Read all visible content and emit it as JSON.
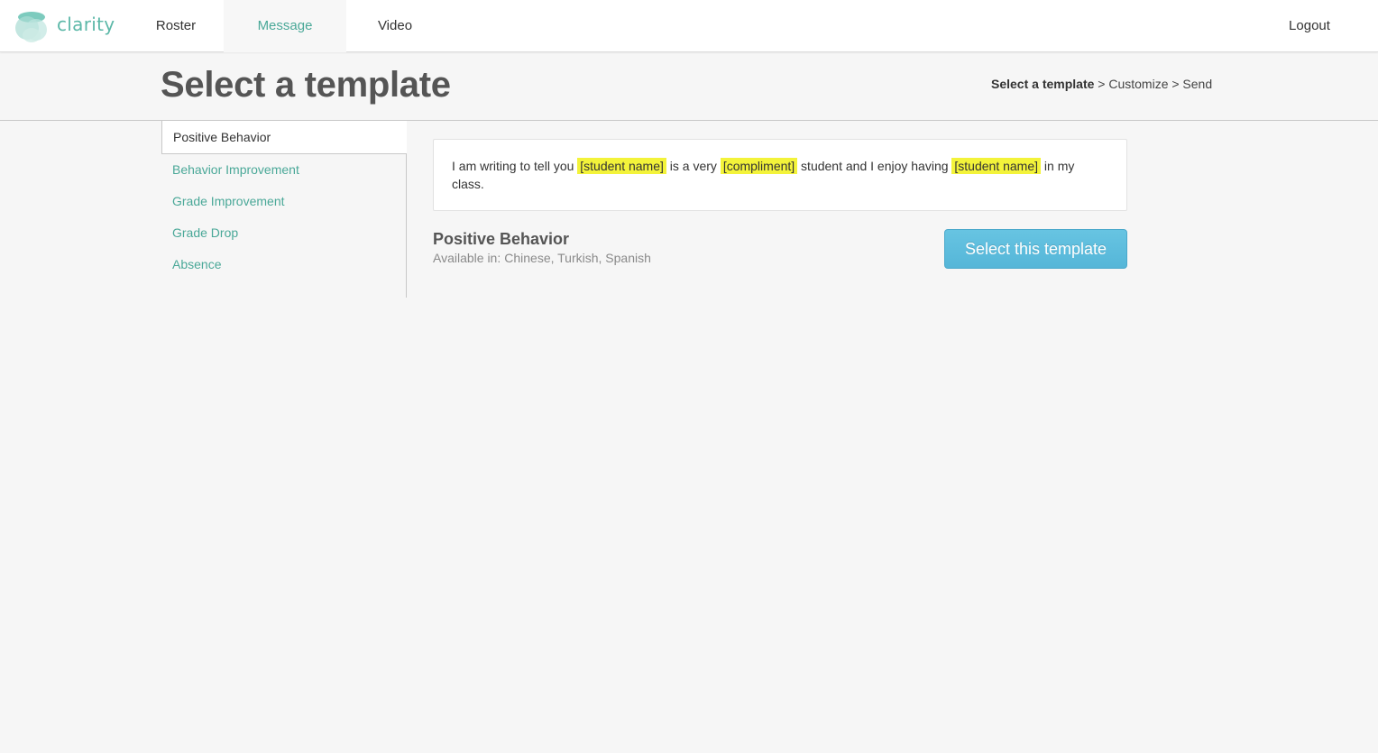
{
  "app": {
    "name": "clarity",
    "logo_icon": "cloud-icon",
    "brand_color": "#5cb8a8"
  },
  "nav": {
    "items": [
      {
        "label": "Roster"
      },
      {
        "label": "Message",
        "active": true
      },
      {
        "label": "Video"
      }
    ],
    "logout_label": "Logout"
  },
  "page": {
    "title": "Select a template",
    "steps": {
      "current": "Select a template",
      "rest": " > Customize > Send"
    }
  },
  "sidebar": {
    "items": [
      {
        "label": "Positive Behavior",
        "active": true
      },
      {
        "label": "Behavior Improvement"
      },
      {
        "label": "Grade Improvement"
      },
      {
        "label": "Grade Drop"
      },
      {
        "label": "Absence"
      }
    ]
  },
  "preview": {
    "parts": [
      "I am writing to tell you ",
      "[student name]",
      " is a very ",
      "[compliment]",
      " student and I enjoy having ",
      "[student name]",
      " in my class."
    ],
    "highlight_color": "#f3f33a"
  },
  "template": {
    "name": "Positive Behavior",
    "languages_label": "Available in:",
    "languages": "Chinese, Turkish, Spanish",
    "select_button": "Select this template",
    "button_color": "#5bbcdd"
  }
}
